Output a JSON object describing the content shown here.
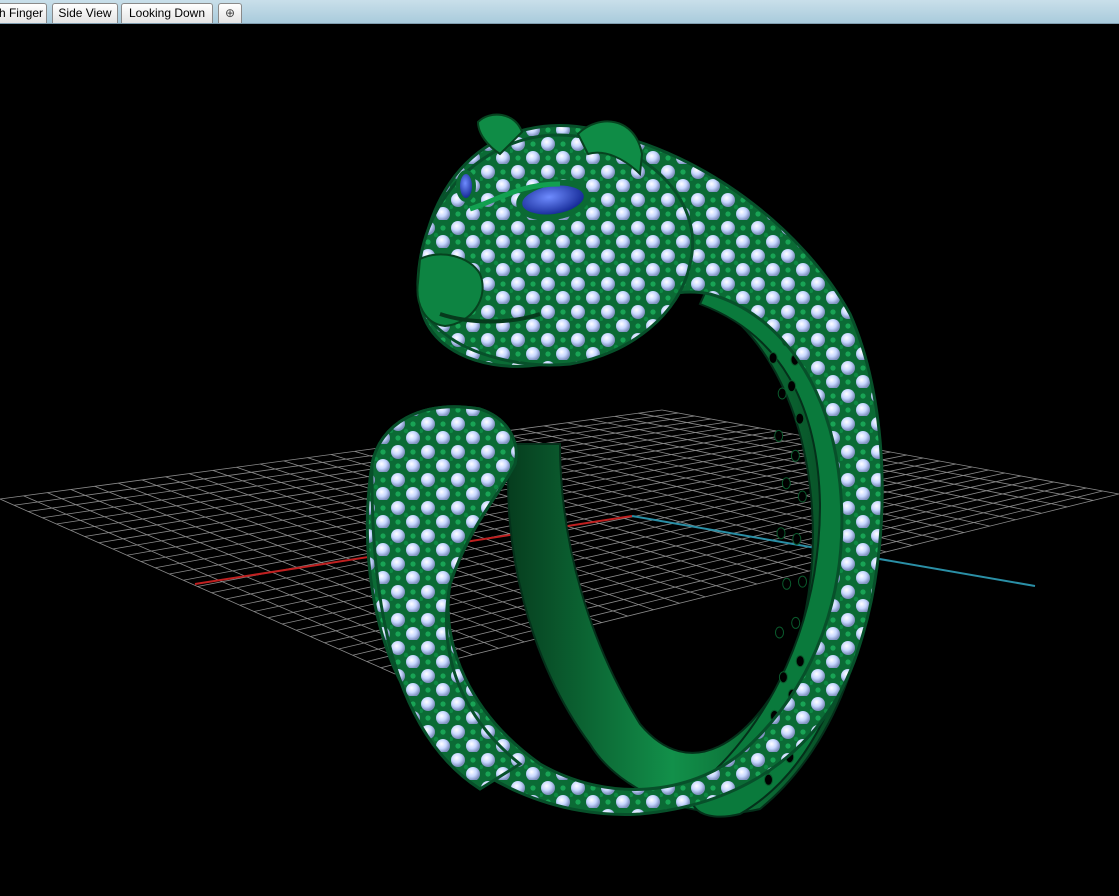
{
  "tabs": [
    {
      "label": "h Finger",
      "active": true
    },
    {
      "label": "Side View",
      "active": false
    },
    {
      "label": "Looking Down",
      "active": false
    }
  ],
  "add_tab_icon": "plus-icon",
  "viewport": {
    "background": "#000000",
    "grid_color": "#8a8a8a",
    "axis_x_color": "#c02020",
    "axis_y_color": "#2a8fa6",
    "metal_color": "#0f7a3e",
    "gem_color": "#c8d8ff",
    "eye_gem_color": "#1535c0",
    "model": "leopard-head-bypass-ring"
  }
}
